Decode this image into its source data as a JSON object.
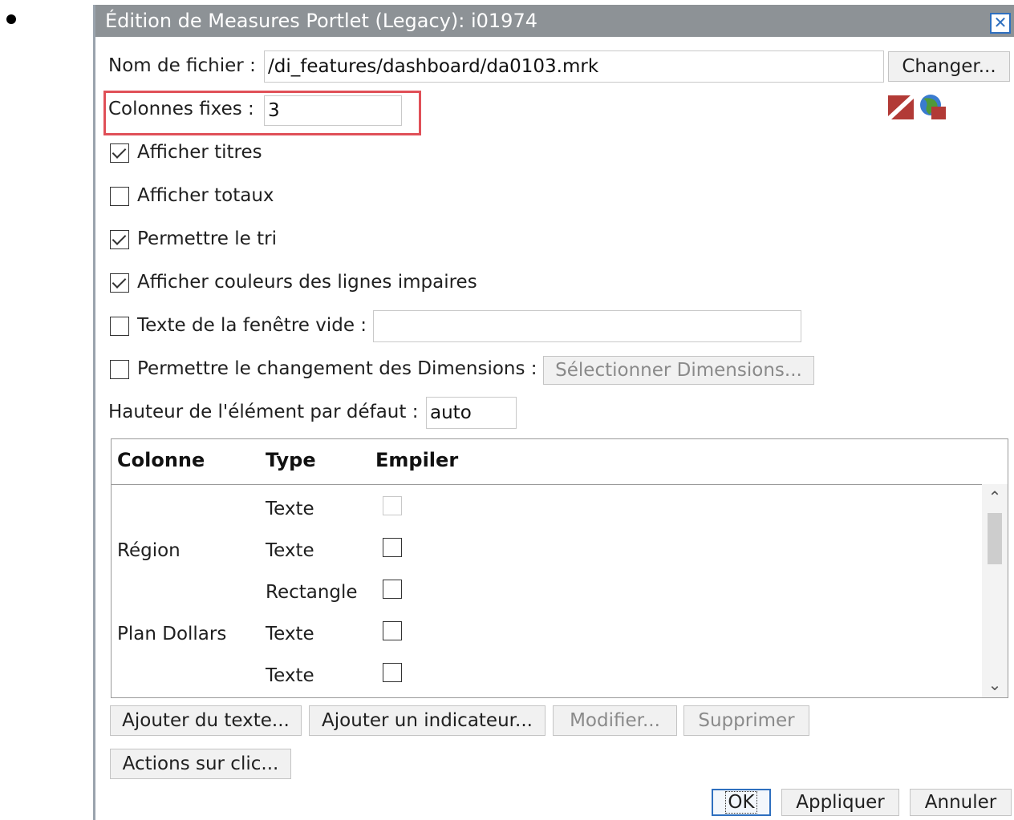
{
  "dialog": {
    "title": "Édition de Measures Portlet (Legacy): i01974",
    "close_glyph": "✕"
  },
  "form": {
    "filename_label": "Nom de fichier :",
    "filename_value": "/di_features/dashboard/da0103.mrk",
    "change_button": "Changer...",
    "fixed_columns_label": "Colonnes fixes :",
    "fixed_columns_value": "3",
    "show_titles": {
      "label": "Afficher titres",
      "checked": true
    },
    "show_totals": {
      "label": "Afficher totaux",
      "checked": false
    },
    "allow_sort": {
      "label": "Permettre le tri",
      "checked": true
    },
    "odd_rows_colors": {
      "label": "Afficher couleurs des lignes impaires",
      "checked": true
    },
    "empty_window_text": {
      "label": "Texte de la fenêtre vide :",
      "checked": false,
      "value": ""
    },
    "allow_dimension_change": {
      "label": "Permettre le changement des Dimensions :",
      "checked": false
    },
    "select_dimensions_button": "Sélectionner Dimensions...",
    "default_height_label": "Hauteur de l'élément par défaut :",
    "default_height_value": "auto"
  },
  "table": {
    "headers": [
      "Colonne",
      "Type",
      "Empiler"
    ],
    "rows": [
      {
        "colonne": "",
        "type": "Texte",
        "empiler": false,
        "empiler_disabled": true
      },
      {
        "colonne": "Région",
        "type": "Texte",
        "empiler": false
      },
      {
        "colonne": "",
        "type": "Rectangle",
        "empiler": false
      },
      {
        "colonne": "Plan Dollars",
        "type": "Texte",
        "empiler": false
      },
      {
        "colonne": "",
        "type": "Texte",
        "empiler": false
      }
    ],
    "scroll_up_glyph": "⌃",
    "scroll_down_glyph": "⌄"
  },
  "actions": {
    "add_text": "Ajouter du texte...",
    "add_indicator": "Ajouter un indicateur...",
    "modify": "Modifier...",
    "delete": "Supprimer",
    "click_actions": "Actions sur clic..."
  },
  "footer": {
    "ok": "OK",
    "apply": "Appliquer",
    "cancel": "Annuler"
  },
  "icons": {
    "edit": "pencil-slash-icon",
    "globe": "globe-icon"
  }
}
